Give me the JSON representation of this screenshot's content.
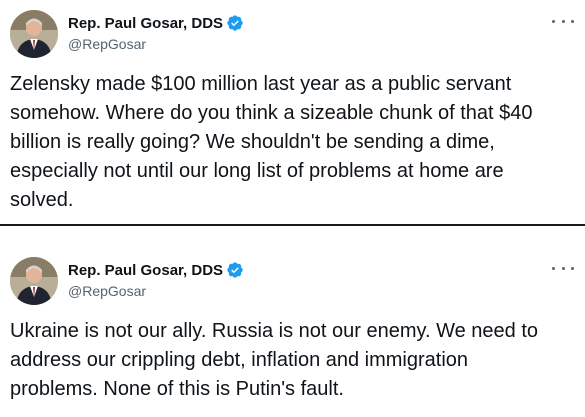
{
  "colors": {
    "text": "#0f1419",
    "secondary_text": "#536471",
    "verified_badge": "#1d9bf0",
    "divider": "#1a1a1a",
    "background": "#ffffff"
  },
  "tweets": [
    {
      "author": {
        "display_name": "Rep. Paul Gosar, DDS",
        "handle": "@RepGosar",
        "verified_icon": "verified-badge-icon",
        "avatar_icon": "profile-photo"
      },
      "more_icon": "more-options-icon",
      "text": "Zelensky made $100 million last year as a public servant somehow. Where do you think a sizeable chunk of that $40 billion is really going? We shouldn't be sending a dime, especially not until our long list of problems at home are solved."
    },
    {
      "author": {
        "display_name": "Rep. Paul Gosar, DDS",
        "handle": "@RepGosar",
        "verified_icon": "verified-badge-icon",
        "avatar_icon": "profile-photo"
      },
      "more_icon": "more-options-icon",
      "text": "Ukraine is not our ally. Russia is not our enemy. We need to address our crippling debt, inflation and immigration problems. None of this is Putin's fault."
    }
  ]
}
